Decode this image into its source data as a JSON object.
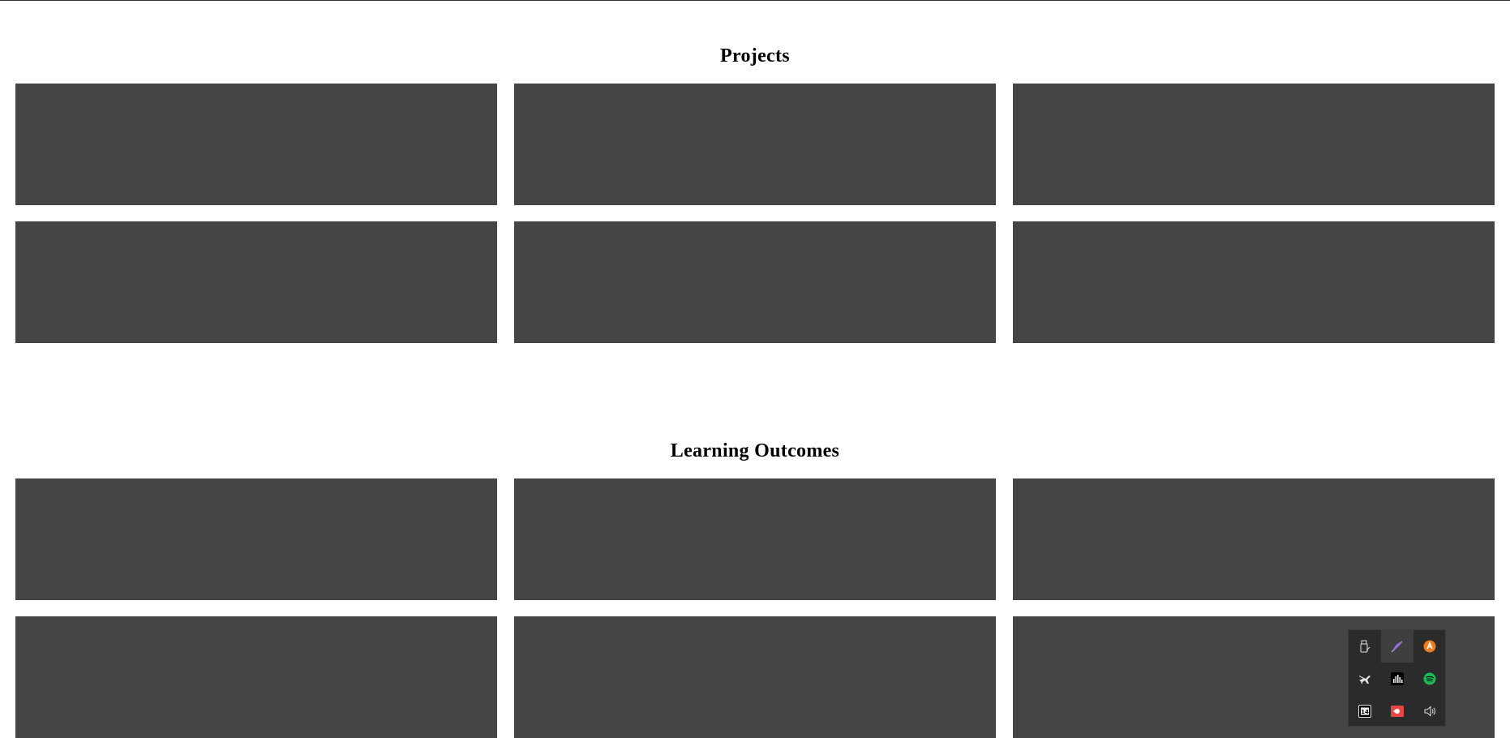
{
  "sections": [
    {
      "title": "Projects",
      "cards": [
        {
          "id": "project-1"
        },
        {
          "id": "project-2"
        },
        {
          "id": "project-3"
        },
        {
          "id": "project-4"
        },
        {
          "id": "project-5"
        },
        {
          "id": "project-6"
        }
      ]
    },
    {
      "title": "Learning Outcomes",
      "cards": [
        {
          "id": "outcome-1"
        },
        {
          "id": "outcome-2"
        },
        {
          "id": "outcome-3"
        },
        {
          "id": "outcome-4"
        },
        {
          "id": "outcome-5"
        },
        {
          "id": "outcome-6"
        }
      ]
    }
  ],
  "system_tray": {
    "icons": [
      {
        "name": "usb-drive-icon"
      },
      {
        "name": "feather-pen-icon",
        "active": true
      },
      {
        "name": "avast-antivirus-icon"
      },
      {
        "name": "airplane-icon"
      },
      {
        "name": "audio-bars-icon"
      },
      {
        "name": "spotify-icon"
      },
      {
        "name": "calendar-14-icon",
        "text": "14"
      },
      {
        "name": "screen-recorder-icon"
      },
      {
        "name": "speaker-volume-icon"
      }
    ]
  },
  "colors": {
    "card": "#454545",
    "heading": "#000000",
    "tray_bg": "#2b2b2b",
    "spotify_green": "#1db954",
    "avast_orange": "#f07d1d",
    "recorder_red": "#e84545",
    "feather_purple": "#9a6fd8"
  }
}
